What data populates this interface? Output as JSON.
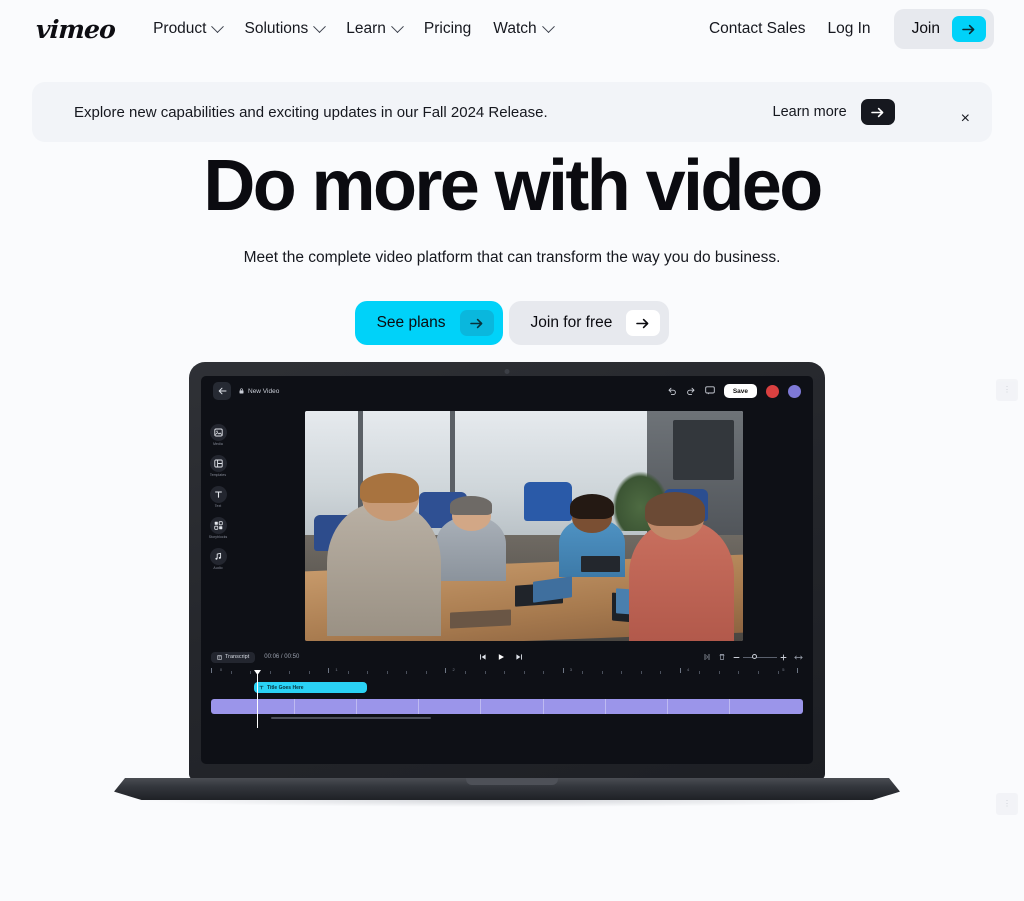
{
  "header": {
    "logo": "vimeo",
    "nav": [
      {
        "label": "Product",
        "icon": "chevron-down-icon",
        "has_chevron": true
      },
      {
        "label": "Solutions",
        "icon": "chevron-down-icon",
        "has_chevron": true
      },
      {
        "label": "Learn",
        "icon": "chevron-down-icon",
        "has_chevron": true
      },
      {
        "label": "Pricing",
        "icon": "none",
        "has_chevron": false
      },
      {
        "label": "Watch",
        "icon": "chevron-down-icon",
        "has_chevron": true
      }
    ],
    "contact_sales": "Contact Sales",
    "log_in": "Log In",
    "join": "Join",
    "join_arrow_icon": "arrow-right-icon"
  },
  "banner": {
    "message": "Explore new capabilities and exciting updates in our Fall 2024 Release.",
    "learn_more": "Learn more",
    "learn_more_arrow_icon": "arrow-right-icon",
    "close_icon": "close-icon",
    "close_label": "×"
  },
  "hero": {
    "headline": "Do more with video",
    "subheadline": "Meet the complete video platform that can transform the way you do business.",
    "cta_primary": "See plans",
    "cta_primary_arrow_icon": "arrow-right-icon",
    "cta_secondary": "Join for free",
    "cta_secondary_arrow_icon": "arrow-right-icon"
  },
  "editor": {
    "back_icon": "arrow-left-icon",
    "lock_icon": "lock-icon",
    "project_title": "New Video",
    "undo_icon": "undo-icon",
    "redo_icon": "redo-icon",
    "comment_icon": "comment-icon",
    "save_label": "Save",
    "avatars": [
      "collaborator-avatar-red",
      "collaborator-avatar-purple"
    ],
    "rail": [
      {
        "label": "Media",
        "icon": "media-icon"
      },
      {
        "label": "Templates",
        "icon": "templates-icon"
      },
      {
        "label": "Text",
        "icon": "text-icon"
      },
      {
        "label": "Storyblocks",
        "icon": "storyblocks-icon"
      },
      {
        "label": "Audio",
        "icon": "audio-icon"
      }
    ],
    "transcript_label": "Transcript",
    "transcript_icon": "transcript-icon",
    "time_display": "00:06 / 00:50",
    "skip_back_icon": "skip-back-icon",
    "play_icon": "play-icon",
    "skip_forward_icon": "skip-forward-icon",
    "split_icon": "split-icon",
    "delete_icon": "trash-icon",
    "zoom_out_icon": "minus-icon",
    "zoom_in_icon": "plus-icon",
    "fit_icon": "fit-to-width-icon",
    "ruler_labels": [
      "0",
      "1",
      "2",
      "3",
      "4",
      "5"
    ],
    "clip_title": "Title Goes Here",
    "clip_title_icon": "text-icon"
  },
  "colors": {
    "page_bg": "#fafbfd",
    "accent_cyan": "#00d2f9",
    "accent_cyan_dark": "#0ab7dd",
    "neutral_pill": "#e7e9ee",
    "banner_bg": "#f2f4f8",
    "ink": "#0b0b10",
    "editor_bg": "#0e1016",
    "clip_cyan": "#2ad2f5",
    "track_purple": "#9b95ea"
  }
}
